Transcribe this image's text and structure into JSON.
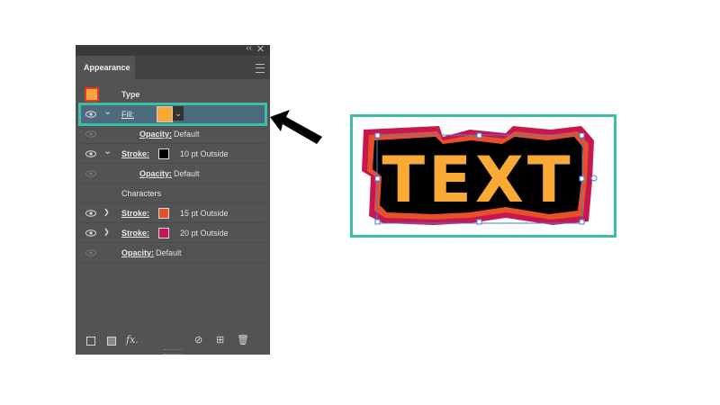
{
  "panel": {
    "tab_label": "Appearance",
    "collapse_glyph": "‹‹",
    "close_glyph": "✕",
    "rows": {
      "type_label": "Type",
      "fill_label": "Fill:",
      "opacity_label": "Opacity:",
      "opacity_value": "Default",
      "stroke_label": "Stroke:",
      "stroke1_value": "10 pt  Outside",
      "characters_label": "Characters",
      "stroke2_value": "15 pt  Outside",
      "stroke3_value": "20 pt  Outside"
    },
    "fx_label": "fx.",
    "chevron_glyph": "❯",
    "chevron_down_glyph": "⌄"
  },
  "artwork_text": "TEXT",
  "colors": {
    "fill_orange": "#f9a935",
    "stroke_black": "#000000",
    "stroke_orange_red": "#e8502a",
    "stroke_crimson": "#c8174e",
    "highlight_teal": "#3cbfa8",
    "panel_bg": "#535353",
    "selected_row": "#4e6b7e"
  },
  "icons": [
    "eye-icon",
    "chevron-right-icon",
    "chevron-down-icon",
    "menu-icon",
    "new-stroke-icon",
    "new-fill-icon",
    "fx-icon",
    "clear-icon",
    "duplicate-icon",
    "trash-icon",
    "arrow-pointer"
  ]
}
